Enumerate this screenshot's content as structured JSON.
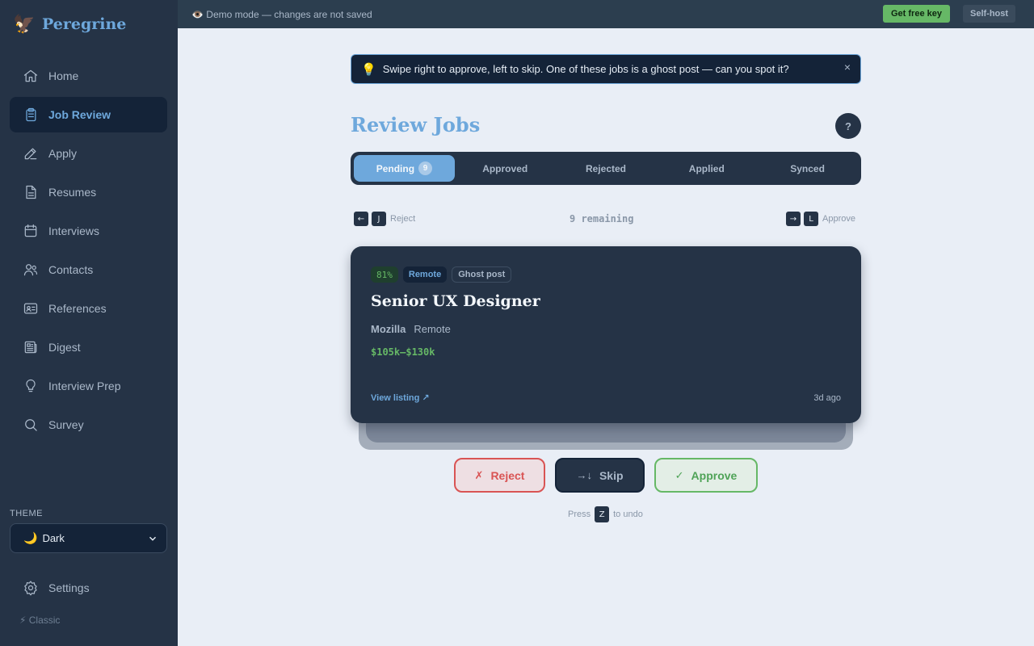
{
  "app": {
    "name": "Peregrine",
    "logo_icon": "eagle-icon"
  },
  "sidebar": {
    "items": [
      {
        "label": "Home",
        "icon": "home-icon",
        "active": false
      },
      {
        "label": "Job Review",
        "icon": "clipboard-icon",
        "active": true
      },
      {
        "label": "Apply",
        "icon": "pencil-icon",
        "active": false
      },
      {
        "label": "Resumes",
        "icon": "document-icon",
        "active": false
      },
      {
        "label": "Interviews",
        "icon": "calendar-icon",
        "active": false
      },
      {
        "label": "Contacts",
        "icon": "users-icon",
        "active": false
      },
      {
        "label": "References",
        "icon": "id-card-icon",
        "active": false
      },
      {
        "label": "Digest",
        "icon": "newspaper-icon",
        "active": false
      },
      {
        "label": "Interview Prep",
        "icon": "lightbulb-icon",
        "active": false
      },
      {
        "label": "Survey",
        "icon": "search-icon",
        "active": false
      }
    ],
    "theme_label": "THEME",
    "theme_value": "Dark",
    "theme_icon": "🌙",
    "settings_label": "Settings",
    "classic_label": "⚡ Classic"
  },
  "topbar": {
    "demo_text": "👁️ Demo mode — changes are not saved",
    "get_key_label": "Get free key",
    "self_host_label": "Self-host"
  },
  "hint": {
    "icon": "💡",
    "text": "Swipe right to approve, left to skip. One of these jobs is a ghost post — can you spot it?",
    "close": "×"
  },
  "page": {
    "title": "Review Jobs",
    "help_label": "?"
  },
  "tabs": [
    {
      "label": "Pending",
      "count": "9",
      "active": true
    },
    {
      "label": "Approved",
      "active": false
    },
    {
      "label": "Rejected",
      "active": false
    },
    {
      "label": "Applied",
      "active": false
    },
    {
      "label": "Synced",
      "active": false
    }
  ],
  "shortcuts": {
    "reject_keys": [
      "←",
      "J"
    ],
    "reject_label": "Reject",
    "remaining": "9 remaining",
    "approve_keys": [
      "→",
      "L"
    ],
    "approve_label": "Approve"
  },
  "card": {
    "score": "81%",
    "remote_badge": "Remote",
    "ghost_badge": "Ghost post",
    "title": "Senior UX Designer",
    "company": "Mozilla",
    "location": "Remote",
    "salary": "$105k–$130k",
    "view_listing": "View listing ↗",
    "posted": "3d ago"
  },
  "actions": {
    "reject_icon": "✗",
    "reject_label": "Reject",
    "skip_icon": "→↓",
    "skip_label": "Skip",
    "approve_icon": "✓",
    "approve_label": "Approve"
  },
  "undo": {
    "prefix": "Press",
    "key": "Z",
    "suffix": "to undo"
  },
  "colors": {
    "accent": "#6ea8dc",
    "sidebar_bg": "#253346",
    "content_bg": "#e9eef6",
    "success": "#66b866",
    "danger": "#d95454"
  }
}
